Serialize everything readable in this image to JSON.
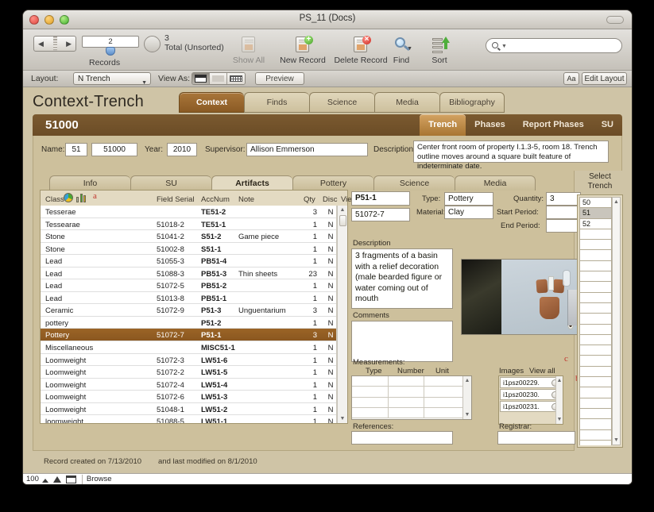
{
  "window": {
    "title": "PS_11 (Docs)"
  },
  "toolbar": {
    "record_number": "2",
    "records_label": "Records",
    "total_count": "3",
    "total_label": "Total (Unsorted)",
    "show_all_label": "Show All",
    "new_record_label": "New Record",
    "delete_record_label": "Delete Record",
    "find_label": "Find",
    "sort_label": "Sort",
    "search_placeholder": ""
  },
  "layoutbar": {
    "layout_label": "Layout:",
    "layout_value": "N Trench",
    "view_as_label": "View As:",
    "preview_label": "Preview",
    "text_format_label": "Aa",
    "edit_layout_label": "Edit Layout"
  },
  "page": {
    "title": "Context-Trench",
    "main_tabs": [
      {
        "label": "Context",
        "active": true
      },
      {
        "label": "Finds",
        "active": false
      },
      {
        "label": "Science",
        "active": false
      },
      {
        "label": "Media",
        "active": false
      },
      {
        "label": "Bibliography",
        "active": false
      }
    ],
    "record_id": "51000",
    "sub_tabs": [
      {
        "label": "Trench",
        "active": true
      },
      {
        "label": "Phases",
        "active": false
      },
      {
        "label": "Report Phases",
        "active": false
      },
      {
        "label": "SU",
        "active": false
      }
    ],
    "fields": {
      "name_label": "Name:",
      "name_value_1": "51",
      "name_value_2": "51000",
      "year_label": "Year:",
      "year_value": "2010",
      "supervisor_label": "Supervisor:",
      "supervisor_value": "Allison Emmerson",
      "description_label": "Description:",
      "description_value": "Center front room of property I.1.3-5, room 18. Trench outline moves around a square built feature of indeterminate date."
    },
    "inner_tabs": [
      {
        "label": "Info",
        "active": false
      },
      {
        "label": "SU",
        "active": false
      },
      {
        "label": "Artifacts",
        "active": true
      },
      {
        "label": "Pottery",
        "active": false
      },
      {
        "label": "Science",
        "active": false
      },
      {
        "label": "Media",
        "active": false
      }
    ]
  },
  "artifacts_table": {
    "columns": [
      "Class",
      "Field Serial",
      "AccNum",
      "Note",
      "Qty",
      "Disc",
      "View"
    ],
    "annotation": "a",
    "rows": [
      {
        "class": "Tesserae",
        "serial": "",
        "acc": "TE51-2",
        "note": "",
        "qty": "3",
        "disc": "N",
        "view": ">",
        "selected": false
      },
      {
        "class": "Tessearae",
        "serial": "51018-2",
        "acc": "TE51-1",
        "note": "",
        "qty": "1",
        "disc": "N",
        "view": ">",
        "selected": false
      },
      {
        "class": "Stone",
        "serial": "51041-2",
        "acc": "S51-2",
        "note": "Game piece",
        "qty": "1",
        "disc": "N",
        "view": ">",
        "selected": false
      },
      {
        "class": "Stone",
        "serial": "51002-8",
        "acc": "S51-1",
        "note": "",
        "qty": "1",
        "disc": "N",
        "view": ">",
        "selected": false
      },
      {
        "class": "Lead",
        "serial": "51055-3",
        "acc": "PB51-4",
        "note": "",
        "qty": "1",
        "disc": "N",
        "view": ">",
        "selected": false
      },
      {
        "class": "Lead",
        "serial": "51088-3",
        "acc": "PB51-3",
        "note": "Thin sheets",
        "qty": "23",
        "disc": "N",
        "view": ">",
        "selected": false
      },
      {
        "class": "Lead",
        "serial": "51072-5",
        "acc": "PB51-2",
        "note": "",
        "qty": "1",
        "disc": "N",
        "view": ">",
        "selected": false
      },
      {
        "class": "Lead",
        "serial": "51013-8",
        "acc": "PB51-1",
        "note": "",
        "qty": "1",
        "disc": "N",
        "view": ">",
        "selected": false
      },
      {
        "class": "Ceramic",
        "serial": "51072-9",
        "acc": "P51-3",
        "note": "Unguentarium",
        "qty": "3",
        "disc": "N",
        "view": ">",
        "selected": false
      },
      {
        "class": "pottery",
        "serial": "",
        "acc": "P51-2",
        "note": "",
        "qty": "1",
        "disc": "N",
        "view": ">",
        "selected": false
      },
      {
        "class": "Pottery",
        "serial": "51072-7",
        "acc": "P51-1",
        "note": "",
        "qty": "3",
        "disc": "N",
        "view": ">",
        "selected": true
      },
      {
        "class": "Miscellaneous",
        "serial": "",
        "acc": "MISC51-1",
        "note": "",
        "qty": "1",
        "disc": "N",
        "view": ">",
        "selected": false
      },
      {
        "class": "Loomweight",
        "serial": "51072-3",
        "acc": "LW51-6",
        "note": "",
        "qty": "1",
        "disc": "N",
        "view": ">",
        "selected": false
      },
      {
        "class": "Loomweight",
        "serial": "51072-2",
        "acc": "LW51-5",
        "note": "",
        "qty": "1",
        "disc": "N",
        "view": ">",
        "selected": false
      },
      {
        "class": "Loomweight",
        "serial": "51072-4",
        "acc": "LW51-4",
        "note": "",
        "qty": "1",
        "disc": "N",
        "view": ">",
        "selected": false
      },
      {
        "class": "Loomweight",
        "serial": "51072-6",
        "acc": "LW51-3",
        "note": "",
        "qty": "1",
        "disc": "N",
        "view": ">",
        "selected": false
      },
      {
        "class": "Loomweight",
        "serial": "51048-1",
        "acc": "LW51-2",
        "note": "",
        "qty": "1",
        "disc": "N",
        "view": ">",
        "selected": false
      },
      {
        "class": "loomweight",
        "serial": "51088-5",
        "acc": "LW51-1",
        "note": "",
        "qty": "1",
        "disc": "N",
        "view": ">",
        "selected": false
      }
    ]
  },
  "detail": {
    "acc_num": "P51-1",
    "field_serial": "51072-7",
    "type_label": "Type:",
    "type_value": "Pottery",
    "material_label": "Material:",
    "material_value": "Clay",
    "quantity_label": "Quantity:",
    "quantity_value": "3",
    "start_period_label": "Start Period:",
    "start_period_value": "",
    "end_period_label": "End Period:",
    "end_period_value": "",
    "description_label": "Description",
    "description_value": "3 fragments of a basin with a relief decoration (male bearded figure or water coming out of mouth",
    "comments_label": "Comments",
    "comments_value": "",
    "measurements_label": "Measurements:",
    "measurement_columns": [
      "Type",
      "Number",
      "Unit"
    ],
    "references_label": "References:",
    "references_value": "",
    "images_label": "Images",
    "view_all_images_label": "View all images",
    "images_annotation": "c",
    "radio_annotation": "b",
    "images": [
      "i1psz00229.",
      "i1psz00230.",
      "i1psz00231."
    ],
    "registrar_label": "Registrar:",
    "registrar_value": ""
  },
  "select_trench": {
    "title_line1": "Select",
    "title_line2": "Trench",
    "options": [
      "50",
      "51",
      "52"
    ],
    "selected": "51"
  },
  "footer": {
    "created_text": "Record created on  7/13/2010",
    "modified_text": "and last modified on  8/1/2010",
    "zoom_level": "100",
    "mode": "Browse"
  },
  "colors": {
    "accent_brown": "#8a5a24",
    "panel_tan": "#cdc09c",
    "header_brown": "#7b5a30",
    "annotation_red": "#c0332b"
  }
}
